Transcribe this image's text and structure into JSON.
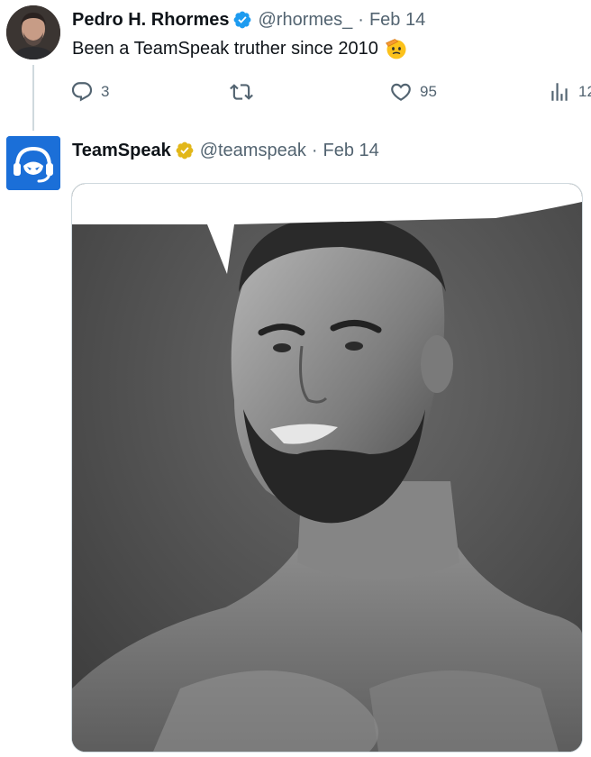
{
  "tweet1": {
    "author_name": "Pedro H. Rhormes",
    "handle": "@rhormes_",
    "separator": "·",
    "date": "Feb 14",
    "verified_badge": "blue-check-icon",
    "text": "Been a TeamSpeak truther since 2010",
    "emoji": "saluting-face-emoji",
    "actions": {
      "reply_count": "3",
      "retweet_count": "",
      "like_count": "95",
      "views_count": "12"
    }
  },
  "tweet2": {
    "author_name": "TeamSpeak",
    "handle": "@teamspeak",
    "separator": "·",
    "date": "Feb 14",
    "verified_badge": "gold-check-icon",
    "media": "meme-image-speech-bubble"
  },
  "colors": {
    "text_primary": "#0f1419",
    "text_secondary": "#536471",
    "verified_blue": "#1d9bf0",
    "verified_gold": "#e2b719",
    "teamspeak_blue": "#1b6fd8",
    "thread_line": "#cfd9de"
  }
}
